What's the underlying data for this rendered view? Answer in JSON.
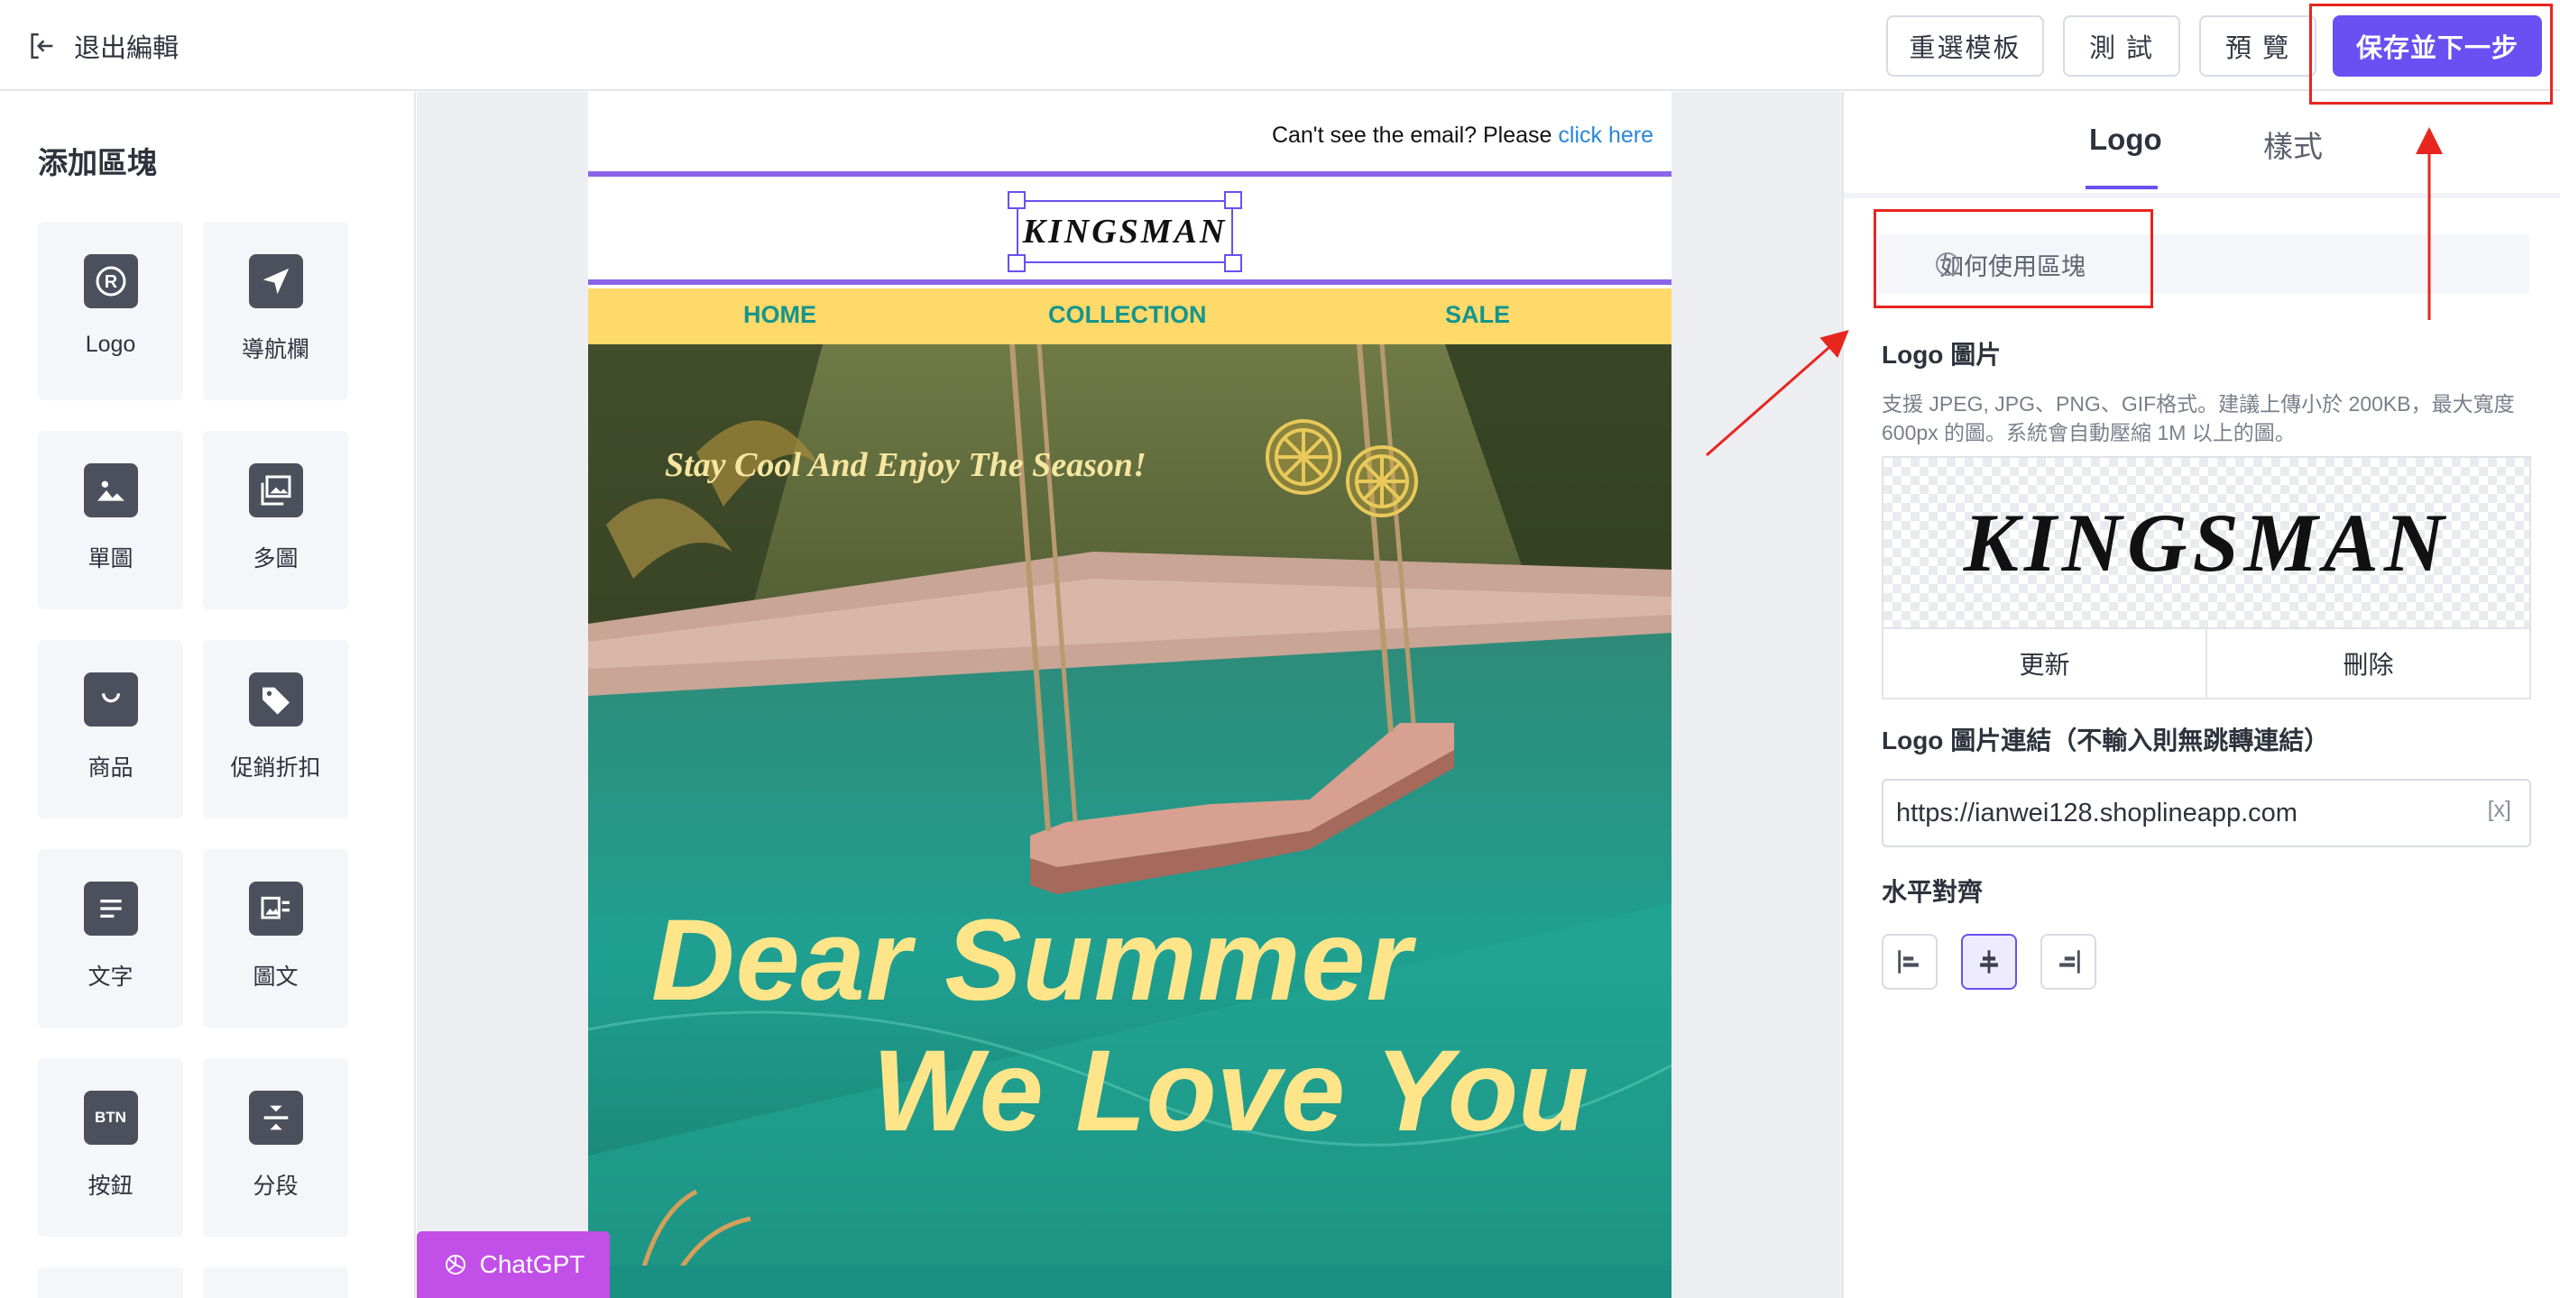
{
  "topbar": {
    "exit_label": "退出編輯",
    "buttons": {
      "reselect": "重選模板",
      "test": "測 試",
      "preview": "預 覽",
      "save_next": "保存並下一步"
    }
  },
  "left_panel": {
    "title": "添加區塊",
    "blocks": [
      {
        "label": "Logo",
        "icon": "logo-r-icon"
      },
      {
        "label": "導航欄",
        "icon": "navigation-arrow-icon"
      },
      {
        "label": "單圖",
        "icon": "image-icon"
      },
      {
        "label": "多圖",
        "icon": "multi-image-icon"
      },
      {
        "label": "商品",
        "icon": "shopping-bag-icon"
      },
      {
        "label": "促銷折扣",
        "icon": "price-tag-icon"
      },
      {
        "label": "文字",
        "icon": "text-icon"
      },
      {
        "label": "圖文",
        "icon": "image-text-icon"
      },
      {
        "label": "按鈕",
        "icon": "button-icon",
        "icon_text": "BTN"
      },
      {
        "label": "分段",
        "icon": "divider-icon"
      }
    ]
  },
  "email": {
    "preheader_text": "Can't see the email? Please ",
    "preheader_link": "click here",
    "logo_text": "KINGSMAN",
    "nav": [
      "HOME",
      "COLLECTION",
      "SALE"
    ],
    "hero_tagline": "Stay Cool And Enjoy The Season!",
    "hero_line1": "Dear Summer",
    "hero_line2": "We Love You"
  },
  "chatgpt_button": "ChatGPT",
  "right_panel": {
    "tabs": [
      "Logo",
      "樣式"
    ],
    "how_to": "如何使用區塊",
    "logo_image_title": "Logo 圖片",
    "logo_image_help": "支援 JPEG, JPG、PNG、GIF格式。建議上傳小於 200KB，最大寬度 600px 的圖。系統會自動壓縮 1M 以上的圖。",
    "logo_preview_text": "KINGSMAN",
    "update_button": "更新",
    "delete_button": "刪除",
    "link_title": "Logo 圖片連結（不輸入則無跳轉連結）",
    "link_value": "https://ianwei128.shoplineapp.com",
    "clear_label": "[x]",
    "align_title": "水平對齊",
    "alignment_selected": "center"
  },
  "colors": {
    "accent": "#6a4ff2",
    "annotation_red": "#e8251f",
    "nav_bg": "#ffd96a",
    "nav_text": "#15958c",
    "chatgpt": "#c24fe8"
  }
}
